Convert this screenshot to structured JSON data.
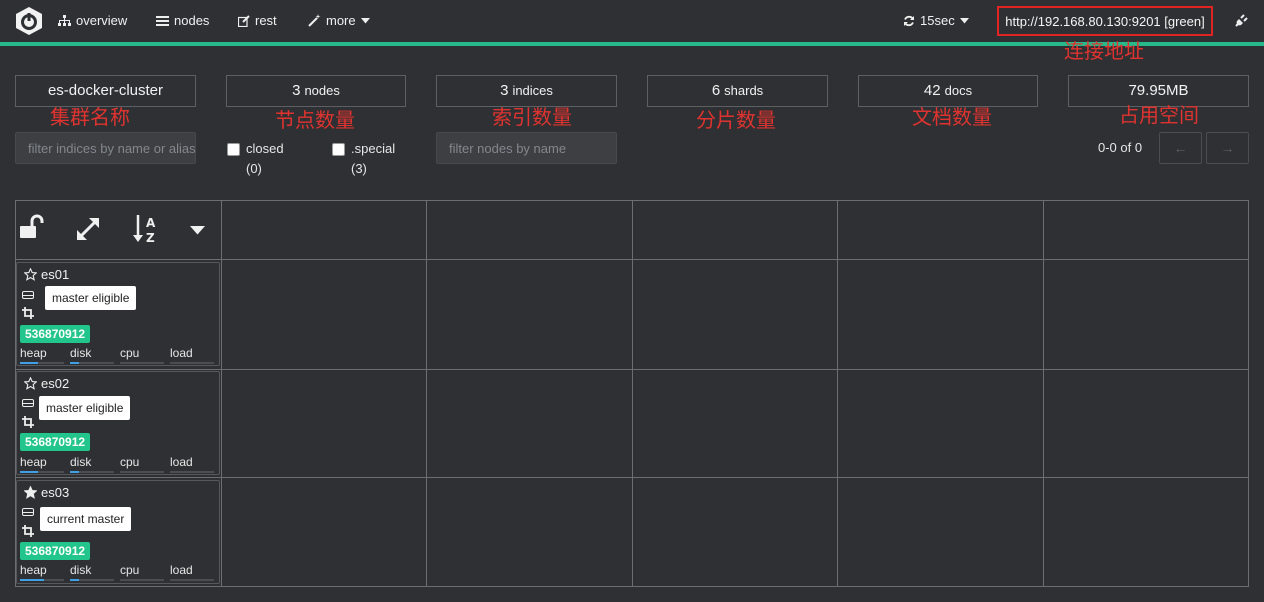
{
  "nav": {
    "overview": "overview",
    "nodes": "nodes",
    "rest": "rest",
    "more": "more",
    "refresh": "15sec",
    "connection": "http://192.168.80.130:9201 [green]"
  },
  "annotations": {
    "connection": "连接地址",
    "cluster_name": "集群名称",
    "nodes": "节点数量",
    "indices": "索引数量",
    "shards": "分片数量",
    "docs": "文档数量",
    "space": "占用空间"
  },
  "stats": {
    "cluster_name": "es-docker-cluster",
    "nodes_num": "3",
    "nodes_unit": "nodes",
    "indices_num": "3",
    "indices_unit": "indices",
    "shards_num": "6",
    "shards_unit": "shards",
    "docs_num": "42",
    "docs_unit": "docs",
    "size": "79.95MB"
  },
  "filters": {
    "indices_placeholder": "filter indices by name or aliases",
    "closed_label": "closed",
    "closed_count": "(0)",
    "special_label": ".special",
    "special_count": "(3)",
    "nodes_placeholder": "filter nodes by name"
  },
  "pager": {
    "text": "0-0 of 0",
    "prev": "←",
    "next": "→"
  },
  "nodes": [
    {
      "name": "es01",
      "role": "master eligible",
      "heap": "536870912",
      "starred": false,
      "fills": {
        "heap": 0.42,
        "disk": 0.2,
        "cpu": 0.0,
        "load": 0.0
      }
    },
    {
      "name": "es02",
      "role": "master eligible",
      "heap": "536870912",
      "starred": false,
      "fills": {
        "heap": 0.42,
        "disk": 0.2,
        "cpu": 0.0,
        "load": 0.0
      }
    },
    {
      "name": "es03",
      "role": "current master",
      "heap": "536870912",
      "starred": true,
      "fills": {
        "heap": 0.55,
        "disk": 0.2,
        "cpu": 0.0,
        "load": 0.0
      }
    }
  ],
  "metrics": {
    "heap": "heap",
    "disk": "disk",
    "cpu": "cpu",
    "load": "load"
  },
  "icons": [
    "logo-icon",
    "sitemap-icon",
    "list-icon",
    "edit-icon",
    "magic-icon",
    "refresh-icon",
    "plug-icon",
    "unlock-icon",
    "expand-icon",
    "sort-alpha-icon",
    "caret-down-icon",
    "star-icon",
    "hdd-icon",
    "crop-icon"
  ],
  "colors": {
    "accent": "#28b98a",
    "badge": "#22c58b",
    "annotation": "#e0332f",
    "highlight_box": "#e02424"
  }
}
